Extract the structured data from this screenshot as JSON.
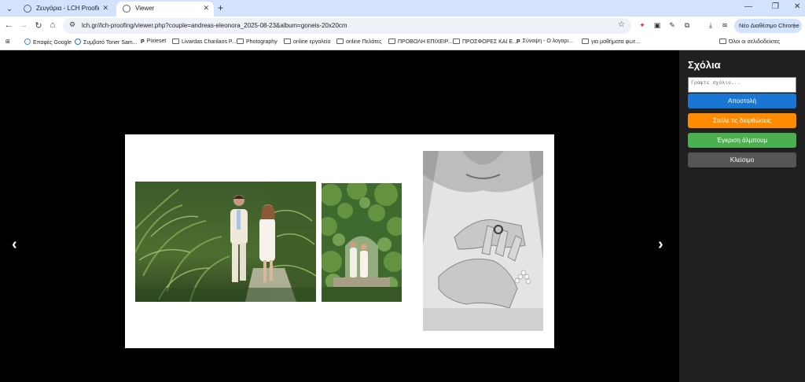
{
  "browser": {
    "tabs": [
      {
        "title": "Ζευγάρια - LCH Proofing"
      },
      {
        "title": "Viewer"
      }
    ],
    "url": "lch.gr//lch-proofing/viewer.php?couple=andreas-eleonora_2025-08-23&album=goneis-20x20cm",
    "promo_label": "Νέο Διαθέσιμο Chrome",
    "bookmarks": [
      "Επαφές Google",
      "Συμβατό Toner Sam...",
      "Pixieset",
      "Livardas Charilaos P...",
      "Photography",
      "online εργαλεία",
      "online Πελάτες",
      "ΠΡΟΒΟΛΗ ΕΠΙΧΕΙΡ...",
      "ΠΡΟΣΦΟΡΕΣ ΚΑΙ Ε...",
      "Σύνοψη - Ο λογαρι...",
      "για μαθήματα φωτ..."
    ],
    "all_bookmarks": "Όλοι οι σελιδοδείκτες"
  },
  "viewer": {
    "prev": "‹",
    "next": "›"
  },
  "sidebar": {
    "title": "Σχόλια",
    "comment_placeholder": "Γράψτε σχόλιο...",
    "buttons": {
      "send": "Αποστολή",
      "send_corrections": "Στείλε τις διορθώσεις",
      "approve": "Έγκριση άλμπουμ",
      "close": "Κλείσιμο"
    }
  },
  "colors": {
    "send": "#1976d2",
    "corrections": "#ff8c00",
    "approve": "#4caf50",
    "close": "#555555"
  }
}
